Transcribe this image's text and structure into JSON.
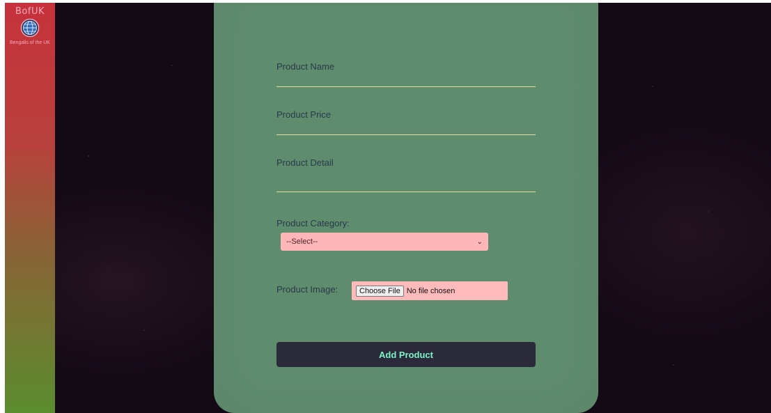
{
  "brand": {
    "logo_text": "BofUK",
    "tagline": "Bengalis of the UK"
  },
  "form": {
    "name_label": "Product Name",
    "price_label": "Product Price",
    "detail_label": "Product Detail",
    "category_label": "Product Category:",
    "category_value": "--Select--",
    "image_label": "Product Image:",
    "choose_file_label": "Choose File",
    "no_file_text": "No file chosen",
    "submit_label": "Add Product"
  },
  "colors": {
    "card": "#608c6e",
    "submit_text": "#7ef5c8",
    "input_underline": "#e8d7a0",
    "select_bg": "#ffb6b6"
  }
}
